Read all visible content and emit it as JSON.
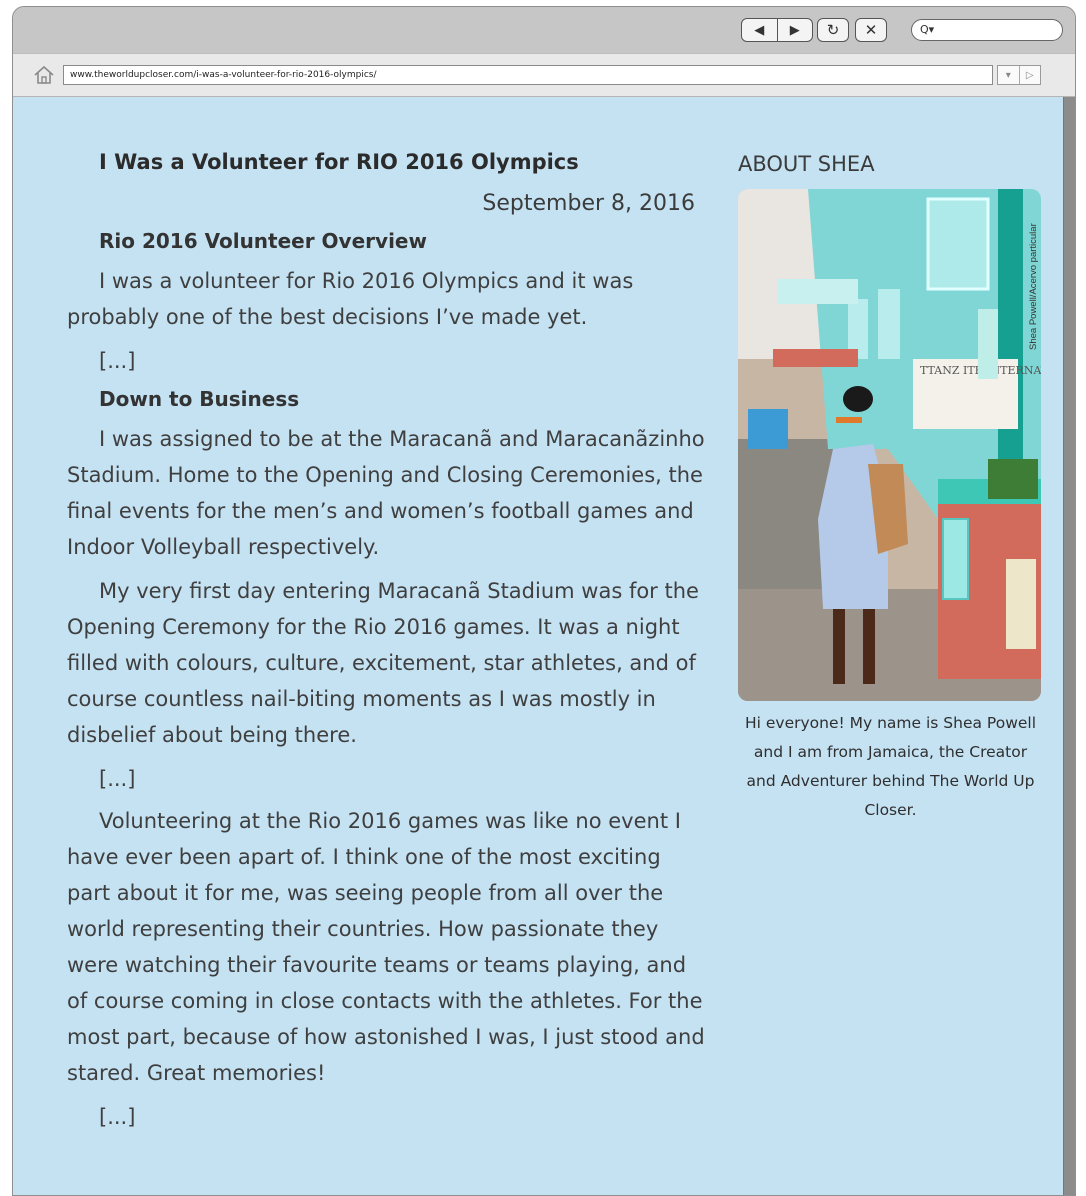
{
  "browser": {
    "nav_back": "◀",
    "nav_forward": "▶",
    "reload_icon": "↻",
    "close_icon": "✕",
    "search_placeholder": "Q▾",
    "url": "www.theworldupcloser.com/i-was-a-volunteer-for-rio-2016-olympics/",
    "addr_dropdown": "▾",
    "addr_go": "▷"
  },
  "article": {
    "title": "I Was a Volunteer for RIO 2016 Olympics",
    "date": "September 8, 2016",
    "section1_heading": "Rio 2016 Volunteer Overview",
    "section1_para": "I was a volunteer for Rio 2016 Olympics and it was probably one of the best decisions I’ve made yet.",
    "ellipsis1": "[...]",
    "section2_heading": "Down to Business",
    "para2": "I was assigned to be at the Maracanã and Maracanãzinho Stadium. Home to the Opening and Closing Ceremonies, the final events for the men’s and women’s football games and Indoor Volleyball respectively.",
    "para3": "My very first day entering Maracanã Stadium was for the Opening Ceremony for the Rio 2016 games. It was a night filled with colours, culture, excitement, star athletes, and of course countless nail-biting moments as I was mostly in disbelief about being there.",
    "ellipsis2": "[...]",
    "para4": "Volunteering at the Rio 2016 games was like no event I have ever been apart of. I think one of the most exciting part about it for me, was seeing people from all over the world representing their countries. How passionate they were watching their favourite teams or teams playing, and of course coming in close contacts with the athletes. For the most part, because of how astonished I was,  I just stood and stared. Great memories!",
    "ellipsis3": "[...]"
  },
  "sidebar": {
    "title": "ABOUT SHEA",
    "caption": "Hi everyone! My name is Shea Powell and I am from Jamaica, the Creator and Adventurer behind The World Up Closer.",
    "photo_credit": "Shea Powell/Acervo particular",
    "photo_sign": "TTANZ  ITE INTERNATIONAL"
  },
  "colors": {
    "page_background": "#c5e2f3",
    "window_chrome": "#c6c6c6",
    "scrollbar": "#8c8c8c"
  }
}
